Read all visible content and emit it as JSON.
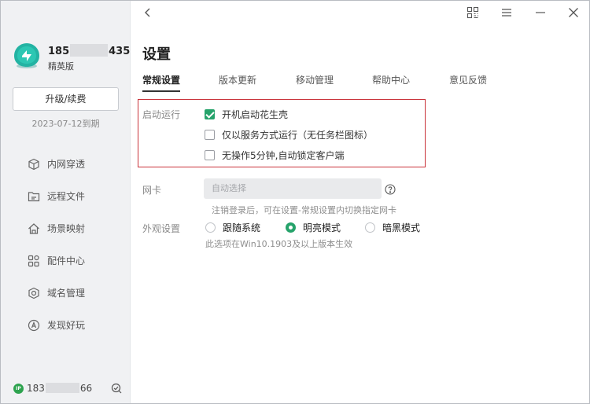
{
  "sidebar": {
    "account": {
      "name_prefix": "185",
      "name_suffix": "435",
      "edition": "精英版"
    },
    "upgrade_button": "升级/续费",
    "expiry": "2023-07-12到期",
    "items": [
      {
        "label": "内网穿透",
        "icon": "cube-icon"
      },
      {
        "label": "远程文件",
        "icon": "folder-icon"
      },
      {
        "label": "场景映射",
        "icon": "home-map-icon"
      },
      {
        "label": "配件中心",
        "icon": "grid-icon"
      },
      {
        "label": "域名管理",
        "icon": "domain-icon"
      },
      {
        "label": "发现好玩",
        "icon": "compass-icon"
      }
    ],
    "ip": {
      "badge": "IP",
      "prefix": "183",
      "suffix": "66"
    }
  },
  "titlebar": {
    "icons": [
      "back-icon",
      "qr-code-icon",
      "menu-icon",
      "minimize-icon",
      "close-icon"
    ]
  },
  "main": {
    "title": "设置",
    "tabs": [
      "常规设置",
      "版本更新",
      "移动管理",
      "帮助中心",
      "意见反馈"
    ],
    "active_tab": "常规设置",
    "startup": {
      "label": "启动运行",
      "options": [
        {
          "label": "开机启动花生壳",
          "checked": true
        },
        {
          "label": "仅以服务方式运行（无任务栏图标）",
          "checked": false
        },
        {
          "label": "无操作5分钟,自动锁定客户端",
          "checked": false
        }
      ]
    },
    "nic": {
      "label": "网卡",
      "placeholder": "自动选择",
      "hint": "注销登录后，可在设置-常规设置内切换指定网卡"
    },
    "appearance": {
      "label": "外观设置",
      "options": [
        {
          "label": "跟随系统",
          "selected": false
        },
        {
          "label": "明亮模式",
          "selected": true
        },
        {
          "label": "暗黑模式",
          "selected": false
        }
      ],
      "hint": "此选项在Win10.1903及以上版本生效"
    }
  },
  "colors": {
    "accent": "#26a36b",
    "highlight_border": "#c9323a",
    "sidebar_bg": "#f0f1f3"
  }
}
